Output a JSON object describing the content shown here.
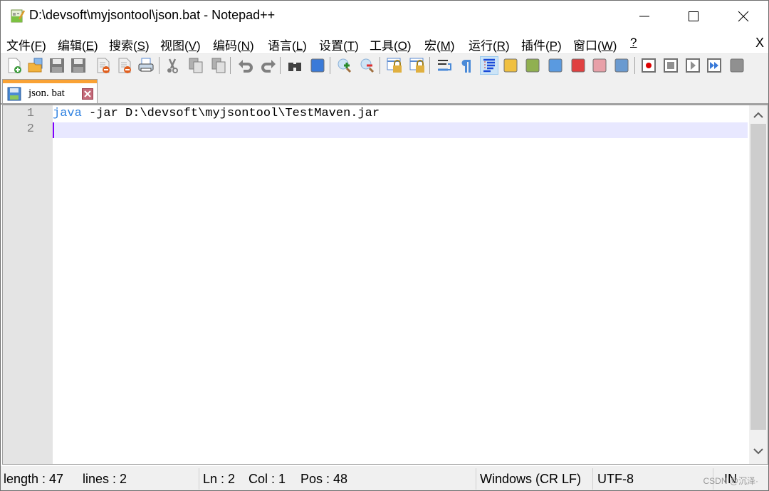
{
  "window": {
    "title": "D:\\devsoft\\myjsontool\\json.bat - Notepad++",
    "controls": [
      "minimize",
      "maximize",
      "close"
    ]
  },
  "menu": {
    "items": [
      {
        "label": "文件(",
        "key": "F",
        "end": ")"
      },
      {
        "label": "编辑(",
        "key": "E",
        "end": ")"
      },
      {
        "label": "搜索(",
        "key": "S",
        "end": ")"
      },
      {
        "label": "视图(",
        "key": "V",
        "end": ")"
      },
      {
        "label": "编码(",
        "key": "N",
        "end": ")"
      },
      {
        "label": "语言(",
        "key": "L",
        "end": ")"
      },
      {
        "label": "设置(",
        "key": "T",
        "end": ")"
      },
      {
        "label": "工具(",
        "key": "O",
        "end": ")"
      },
      {
        "label": "宏(",
        "key": "M",
        "end": ")"
      },
      {
        "label": "运行(",
        "key": "R",
        "end": ")"
      },
      {
        "label": "插件(",
        "key": "P",
        "end": ")"
      },
      {
        "label": "窗口(",
        "key": "W",
        "end": ")"
      },
      {
        "label": "",
        "key": "?",
        "end": ""
      }
    ],
    "close_label": "X"
  },
  "toolbar": {
    "icons": [
      "new-file-icon",
      "open-file-icon",
      "save-icon",
      "save-all-icon",
      "close-icon",
      "close-all-icon",
      "print-icon",
      "cut-icon",
      "copy-icon",
      "paste-icon",
      "undo-icon",
      "redo-icon",
      "find-icon",
      "replace-icon",
      "zoom-in-icon",
      "zoom-out-icon",
      "sync-vertical-icon",
      "sync-horizontal-icon",
      "word-wrap-icon",
      "show-all-chars-icon",
      "indent-guide-icon",
      "udl-icon",
      "doc-map-icon",
      "doc-list-icon",
      "function-list-icon",
      "folder-workspace-icon",
      "monitoring-icon",
      "record-macro-icon",
      "stop-macro-icon",
      "play-macro-icon",
      "run-macro-multiple-icon",
      "save-macro-icon"
    ],
    "active": "indent-guide-icon"
  },
  "tabs": [
    {
      "label": "json. bat",
      "active": true
    }
  ],
  "editor": {
    "lines": [
      {
        "num": "1",
        "keyword": "java",
        "rest": " -jar D:\\devsoft\\myjsontool\\TestMaven.jar"
      },
      {
        "num": "2",
        "keyword": "",
        "rest": ""
      }
    ],
    "current_line": 2
  },
  "status": {
    "length": "length : 47",
    "lines": "lines : 2",
    "ln": "Ln : 2",
    "col": "Col : 1",
    "pos": "Pos : 48",
    "eol": "Windows (CR LF)",
    "encoding": "UTF-8",
    "mode": "IN",
    "watermark": "CSDN @沉泽·"
  },
  "colors": {
    "tab_accent": "#f9a235",
    "keyword": "#2b7fe0",
    "current_line": "#e8e8ff",
    "caret": "#8000ff"
  }
}
